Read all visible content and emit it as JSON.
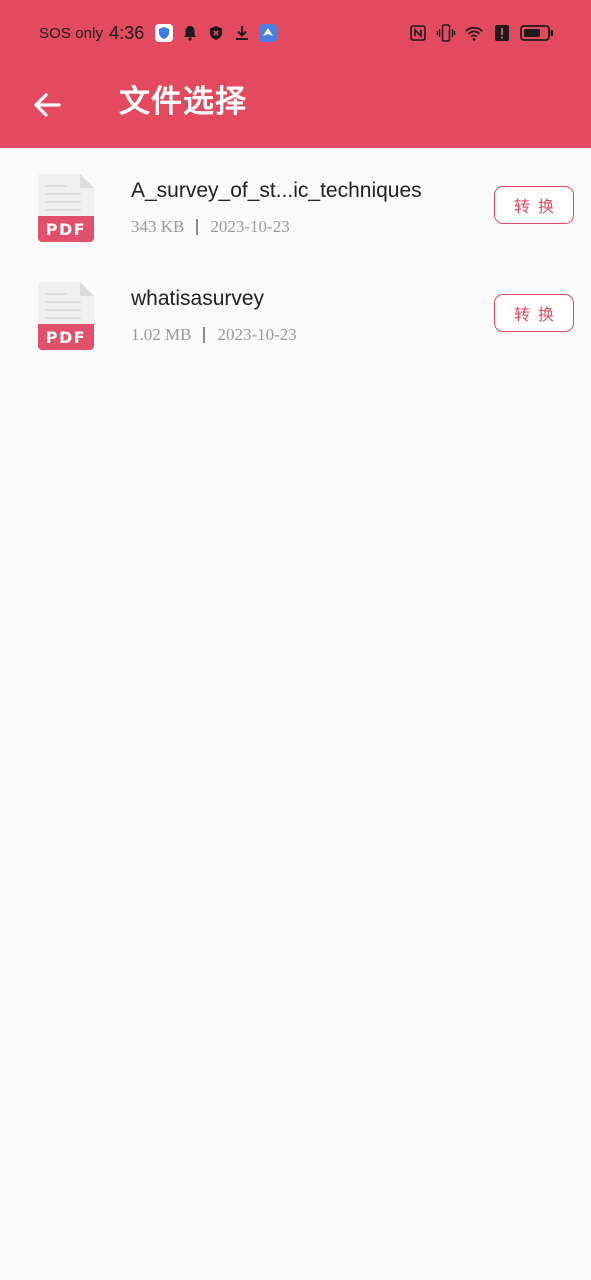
{
  "status_bar": {
    "carrier": "SOS only",
    "time": "4:36",
    "left_icons": [
      "shield-app-icon",
      "bell-icon",
      "security-icon",
      "download-icon",
      "app-bird-icon"
    ],
    "right_icons": [
      "nfc-icon",
      "vibrate-icon",
      "wifi-icon",
      "alert-icon",
      "battery-icon"
    ]
  },
  "toolbar": {
    "title": "文件选择",
    "back_icon": "arrow-left-icon"
  },
  "files": [
    {
      "name": "A_survey_of_st...ic_techniques",
      "size": "343 KB",
      "date": "2023-10-23",
      "icon_label": "PDF",
      "action_label": "转换"
    },
    {
      "name": "whatisasurvey",
      "size": "1.02 MB",
      "date": "2023-10-23",
      "icon_label": "PDF",
      "action_label": "转换"
    }
  ],
  "colors": {
    "primary": "#e44a5f",
    "background": "#fafafa",
    "pdf_badge": "#e0506a"
  }
}
